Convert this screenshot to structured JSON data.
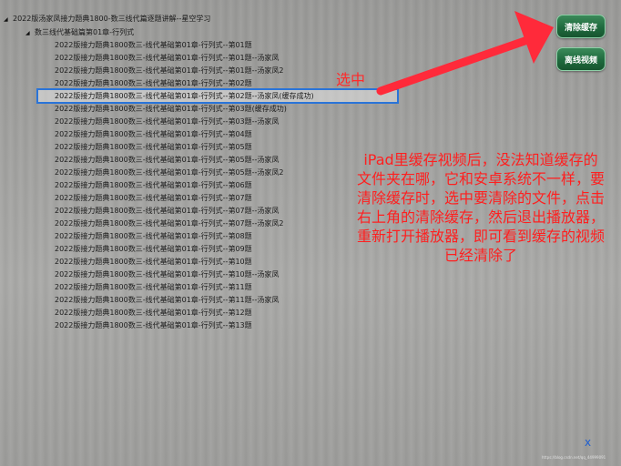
{
  "tree": {
    "root_label": "2022版汤家凤接力题典1800-数三线代篇逐题讲解--星空学习",
    "sub_label": "数三线代基础篇第01章-行列式",
    "items": [
      "2022版接力题典1800数三-线代基础第01章-行列式--第01题",
      "2022版接力题典1800数三-线代基础第01章-行列式--第01题--汤家凤",
      "2022版接力题典1800数三-线代基础第01章-行列式--第01题--汤家凤2",
      "2022版接力题典1800数三-线代基础第01章-行列式--第02题",
      "2022版接力题典1800数三-线代基础第01章-行列式--第02题--汤家凤(缓存成功)",
      "2022版接力题典1800数三-线代基础第01章-行列式--第03题(缓存成功)",
      "2022版接力题典1800数三-线代基础第01章-行列式--第03题--汤家凤",
      "2022版接力题典1800数三-线代基础第01章-行列式--第04题",
      "2022版接力题典1800数三-线代基础第01章-行列式--第05题",
      "2022版接力题典1800数三-线代基础第01章-行列式--第05题--汤家凤",
      "2022版接力题典1800数三-线代基础第01章-行列式--第05题--汤家凤2",
      "2022版接力题典1800数三-线代基础第01章-行列式--第06题",
      "2022版接力题典1800数三-线代基础第01章-行列式--第07题",
      "2022版接力题典1800数三-线代基础第01章-行列式--第07题--汤家凤",
      "2022版接力题典1800数三-线代基础第01章-行列式--第07题--汤家凤2",
      "2022版接力题典1800数三-线代基础第01章-行列式--第08题",
      "2022版接力题典1800数三-线代基础第01章-行列式--第09题",
      "2022版接力题典1800数三-线代基础第01章-行列式--第10题",
      "2022版接力题典1800数三-线代基础第01章-行列式--第10题--汤家凤",
      "2022版接力题典1800数三-线代基础第01章-行列式--第11题",
      "2022版接力题典1800数三-线代基础第01章-行列式--第11题--汤家凤",
      "2022版接力题典1800数三-线代基础第01章-行列式--第12题",
      "2022版接力题典1800数三-线代基础第01章-行列式--第13题"
    ],
    "selected_index": 4
  },
  "annotation": {
    "selected_label": "选中",
    "note": "iPad里缓存视频后，没法知道缓存的文件夹在哪，它和安卓系统不一样，要清除缓存时，选中要清除的文件，点击右上角的清除缓存，然后退出播放器，重新打开播放器，即可看到缓存的视频已经清除了",
    "arrow_color": "#ff2a3a"
  },
  "buttons": {
    "clear_cache": "清除缓存",
    "exit_video": "离线视频"
  },
  "close_label": "x",
  "watermark": "https://blog.csdn.net/qq_44999091"
}
